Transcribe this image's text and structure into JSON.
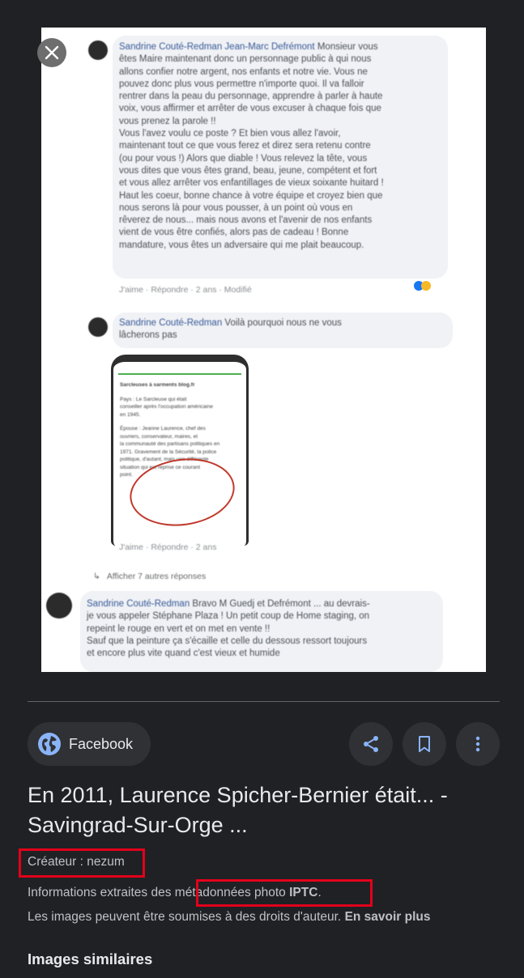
{
  "preview": {
    "comments": [
      {
        "author": "Sandrine Couté-Redman",
        "mention": "Jean-Marc Defrémont",
        "lines": [
          "Monsieur vous",
          "êtes Maire maintenant donc un personnage public à qui nous",
          "allons confier notre argent, nos enfants et notre vie. Vous ne",
          "pouvez donc plus vous permettre n'importe quoi. Il va falloir",
          "rentrer dans la peau du personnage, apprendre à parler à haute",
          "voix, vous affirmer et arrêter de vous excuser à chaque fois que",
          "vous prenez la parole !!",
          "Vous l'avez voulu ce poste ? Et bien vous allez l'avoir,",
          "maintenant tout ce que vous ferez et direz sera retenu contre",
          "(ou pour vous !) Alors que diable ! Vous relevez la tête, vous",
          "vous dites que vous êtes grand, beau, jeune, compétent et fort",
          "et vous allez arrêter vos enfantillages de vieux soixante huitard !",
          "Haut les coeur, bonne chance à votre équipe et croyez bien que",
          "nous serons là pour vous pousser, à un point où vous en",
          "rêverez de nous... mais nous avons et l'avenir de nos enfants",
          "vient de vous être confiés, alors pas de cadeau ! Bonne",
          "mandature, vous êtes un adversaire qui me plait beaucoup."
        ],
        "meta": "J'aime · Répondre · 2 ans · Modifié"
      },
      {
        "author": "Sandrine Couté-Redman",
        "lines": [
          "Voilà pourquoi nous ne vous",
          "lâcherons pas"
        ],
        "meta": "J'aime · Répondre · 2 ans"
      }
    ],
    "screenshot_text": [
      "Sarcleuses à sarments blog.fr",
      "Pays : Le Sarcleuse qui était",
      "conseiller après l'occupation américaine",
      "en 1945.",
      "Épouse : Jeanne Laurence, chef des",
      "ouvriers, conservateur, maires, et",
      "la communauté des partisans politiques en",
      "1971. Gravement de la Sécurité, la police",
      "politique, d'autant, mais une différente",
      "situation qui est reprise ce courant",
      "point."
    ],
    "more_replies": "Afficher 7 autres réponses",
    "last_comment": {
      "author": "Sandrine Couté-Redman",
      "lines": [
        "Bravo M Guedj et Defrémont ... au devrais-",
        "je vous appeler Stéphane Plaza ! Un petit coup de Home staging, on",
        "repeint le rouge en vert et on met en vente !!",
        "Sauf que la peinture ça s'écaille et celle du dessous ressort toujours",
        "et encore plus vite quand c'est vieux et humide"
      ]
    }
  },
  "source": {
    "name": "Facebook"
  },
  "actions": {
    "share": "share-icon",
    "save": "bookmark-icon",
    "more": "more-vert-icon"
  },
  "result": {
    "title": "En 2011, Laurence Spicher-Bernier était... - Savingrad-Sur-Orge ...",
    "creator": "Créateur : nezum",
    "metadata_prefix": "Informations extraites des ",
    "metadata_link": "métadonnées photo",
    "metadata_bold": "IPTC",
    "metadata_suffix": ".",
    "rights_text": "Les images peuvent être soumises à des droits d'auteur.",
    "learn_more": "En savoir plus"
  },
  "similar": {
    "heading": "Images similaires"
  },
  "colors": {
    "background": "#202124",
    "chip": "#303134",
    "accent_blue": "#8ab4f8",
    "highlight_red": "#e3001b"
  }
}
